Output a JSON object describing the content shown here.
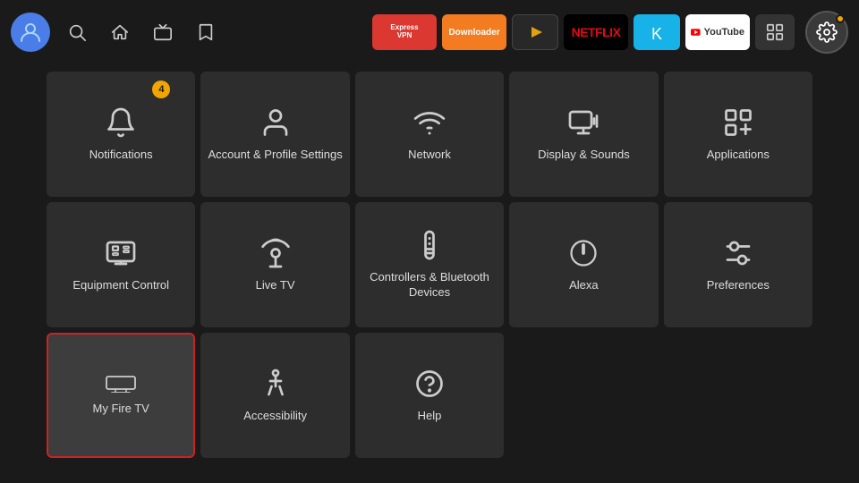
{
  "topbar": {
    "avatar_initial": "👤",
    "nav_icons": [
      "search",
      "home",
      "tv",
      "bookmark"
    ],
    "apps": [
      {
        "id": "expressvpn",
        "label": "Express\nVPN",
        "color": "#da3831"
      },
      {
        "id": "downloader",
        "label": "Downloader",
        "color": "#f47c20"
      },
      {
        "id": "plex",
        "label": "▶",
        "color": "#e5a00d"
      },
      {
        "id": "netflix",
        "label": "NETFLIX",
        "color": "#e50914"
      },
      {
        "id": "kodi",
        "label": "⬡",
        "color": "#17b2e8"
      },
      {
        "id": "youtube",
        "label": "YouTube",
        "color": "#ff0000"
      }
    ],
    "settings_label": "⚙"
  },
  "grid": {
    "cells": [
      {
        "id": "notifications",
        "label": "Notifications",
        "badge": "4",
        "selected": false,
        "icon": "bell"
      },
      {
        "id": "account-profile",
        "label": "Account & Profile Settings",
        "badge": null,
        "selected": false,
        "icon": "person"
      },
      {
        "id": "network",
        "label": "Network",
        "badge": null,
        "selected": false,
        "icon": "wifi"
      },
      {
        "id": "display-sounds",
        "label": "Display & Sounds",
        "badge": null,
        "selected": false,
        "icon": "display-sound"
      },
      {
        "id": "applications",
        "label": "Applications",
        "badge": null,
        "selected": false,
        "icon": "apps"
      },
      {
        "id": "equipment-control",
        "label": "Equipment Control",
        "badge": null,
        "selected": false,
        "icon": "monitor"
      },
      {
        "id": "live-tv",
        "label": "Live TV",
        "badge": null,
        "selected": false,
        "icon": "antenna"
      },
      {
        "id": "controllers-bluetooth",
        "label": "Controllers & Bluetooth Devices",
        "badge": null,
        "selected": false,
        "icon": "remote"
      },
      {
        "id": "alexa",
        "label": "Alexa",
        "badge": null,
        "selected": false,
        "icon": "alexa"
      },
      {
        "id": "preferences",
        "label": "Preferences",
        "badge": null,
        "selected": false,
        "icon": "sliders"
      },
      {
        "id": "my-fire-tv",
        "label": "My Fire TV",
        "badge": null,
        "selected": true,
        "icon": "firetv"
      },
      {
        "id": "accessibility",
        "label": "Accessibility",
        "badge": null,
        "selected": false,
        "icon": "accessibility"
      },
      {
        "id": "help",
        "label": "Help",
        "badge": null,
        "selected": false,
        "icon": "help"
      }
    ]
  }
}
